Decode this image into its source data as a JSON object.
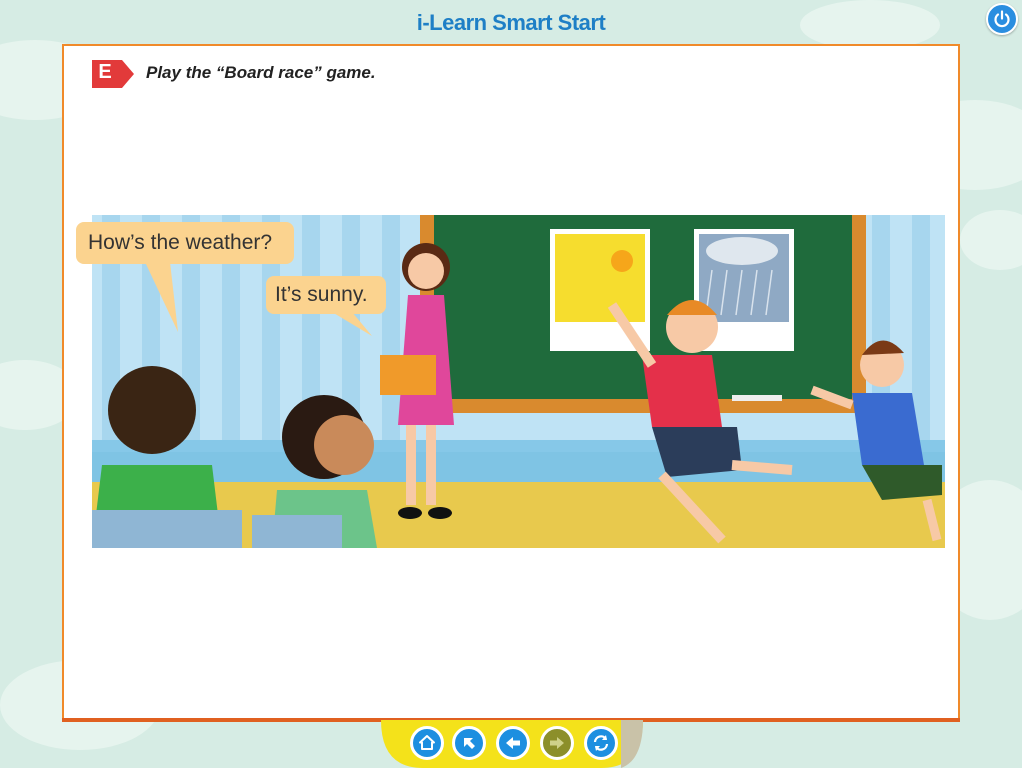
{
  "app": {
    "title": "i-Learn Smart Start"
  },
  "exercise": {
    "badge": "E",
    "instruction": "Play the “Board race” game."
  },
  "scene": {
    "bubbles": [
      "How’s the weather?",
      "It’s sunny."
    ]
  },
  "nav": {
    "buttons": [
      {
        "name": "home",
        "icon": "home-icon",
        "enabled": true
      },
      {
        "name": "up",
        "icon": "arrow-up-left-icon",
        "enabled": true
      },
      {
        "name": "back",
        "icon": "arrow-left-icon",
        "enabled": true
      },
      {
        "name": "next",
        "icon": "arrow-right-icon",
        "enabled": false
      },
      {
        "name": "refresh",
        "icon": "refresh-icon",
        "enabled": true
      }
    ]
  },
  "colors": {
    "accent": "#1e7fc6",
    "page_border": "#f08a2a",
    "badge": "#e23a3a",
    "nav_bar": "#f4e21a"
  }
}
